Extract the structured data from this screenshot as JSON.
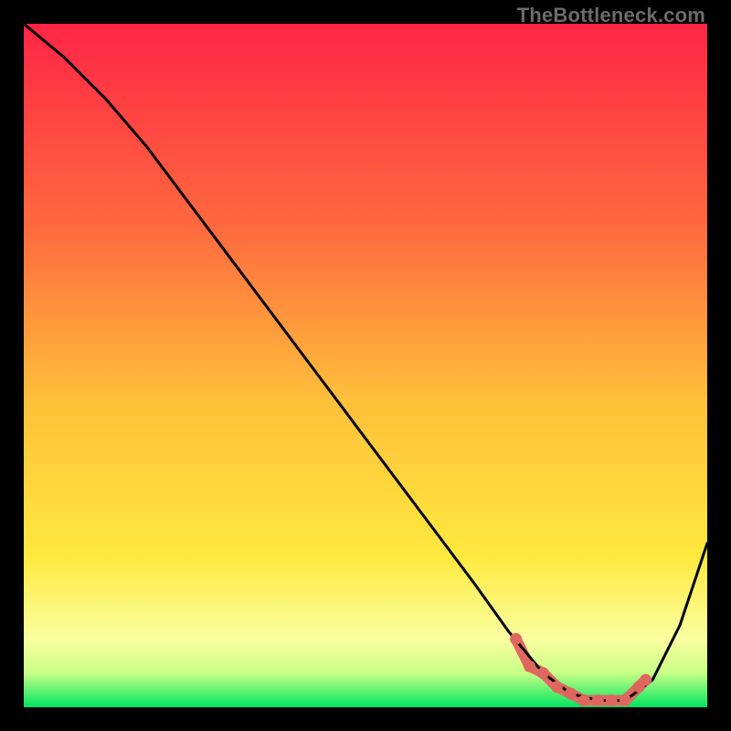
{
  "watermark": "TheBottleneck.com",
  "colors": {
    "background_black": "#000000",
    "gradient_top": "#ff2545",
    "gradient_mid1": "#ff8040",
    "gradient_mid2": "#ffe040",
    "gradient_light": "#ffff99",
    "gradient_bottom": "#00e562",
    "curve_color": "#000000",
    "highlight_color": "#e2695f",
    "highlight_dot_fill": "#de665e"
  },
  "chart_data": {
    "type": "line",
    "title": "",
    "xlabel": "",
    "ylabel": "",
    "xlim": [
      0,
      100
    ],
    "ylim": [
      0,
      100
    ],
    "grid": false,
    "series": [
      {
        "name": "bottleneck-curve",
        "x": [
          0,
          6,
          12,
          18,
          24,
          30,
          36,
          42,
          48,
          54,
          60,
          66,
          71,
          76,
          80,
          84,
          88,
          92,
          96,
          100
        ],
        "y": [
          100,
          95,
          89,
          82,
          74,
          66,
          58,
          50,
          42,
          34,
          26,
          18,
          11,
          5,
          2,
          1,
          1,
          4,
          12,
          24
        ]
      }
    ],
    "highlight_range": {
      "x_start": 72,
      "x_end": 91,
      "description": "minimum-bottleneck plateau"
    },
    "highlight_points": {
      "x": [
        72,
        74,
        76,
        78,
        80,
        82,
        84,
        86,
        88,
        90,
        91
      ],
      "y": [
        10,
        6,
        5,
        3,
        2,
        1,
        1,
        1,
        1,
        3,
        4
      ]
    }
  }
}
